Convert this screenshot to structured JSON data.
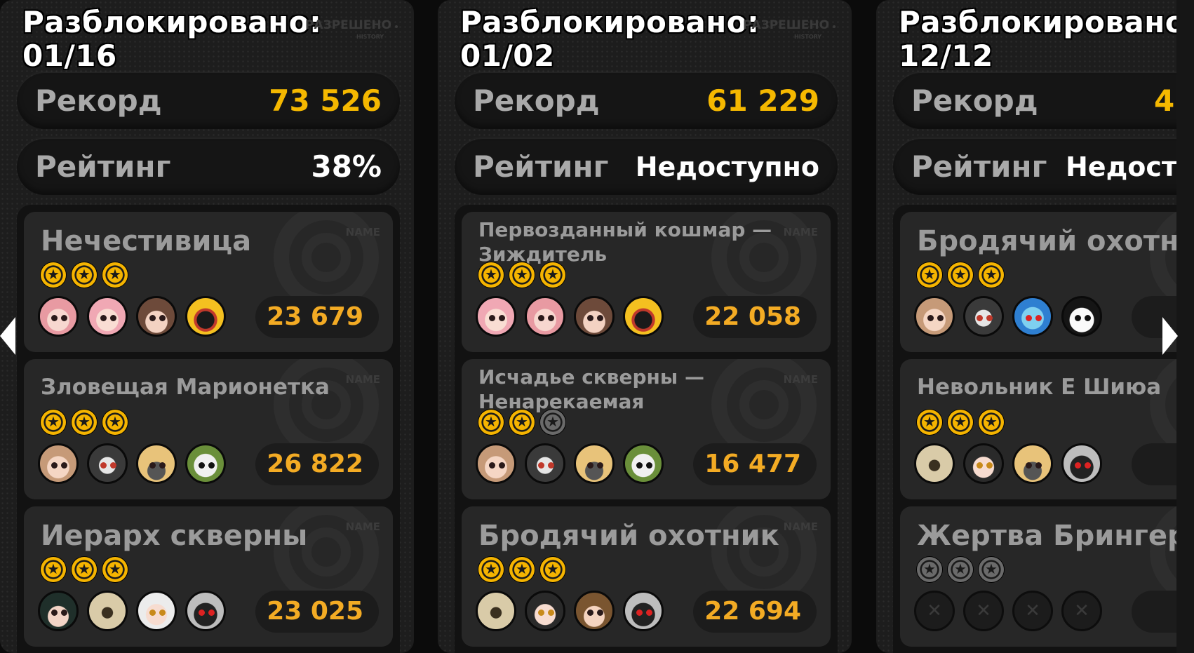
{
  "panels": [
    {
      "unlocked_label": "Разблокировано:",
      "unlocked_count": "01/16",
      "history_tag": "РАЗРЕШЕНО",
      "history_sub": "HISTORY",
      "record_label": "Рекорд",
      "record_value": "73 526",
      "rating_label": "Рейтинг",
      "rating_value": "38%",
      "cards": [
        {
          "title": "Нечестивица",
          "name_tag": "NAME",
          "score": "23 679",
          "stars": [
            true,
            true,
            true
          ],
          "avatars": [
            "pink-hair-girl-avatar",
            "pink-hair-girl-avatar",
            "brown-hair-girl-avatar",
            "yellow-hood-avatar"
          ]
        },
        {
          "title": "Зловещая Марионетка",
          "name_tag": "NAME",
          "score": "26 822",
          "stars": [
            true,
            true,
            true
          ],
          "avatars": [
            "blonde-girl-avatar",
            "bear-mascot-avatar",
            "blonde-mask-avatar",
            "robot-mascot-avatar"
          ]
        },
        {
          "title": "Иерарх скверны",
          "name_tag": "NAME",
          "score": "23 025",
          "stars": [
            true,
            true,
            true
          ],
          "avatars": [
            "dark-hair-girl-avatar",
            "armored-helmet-avatar",
            "white-hair-girl-avatar",
            "black-cat-robot-avatar"
          ]
        }
      ]
    },
    {
      "unlocked_label": "Разблокировано:",
      "unlocked_count": "01/02",
      "history_tag": "РАЗРЕШЕНО",
      "history_sub": "HISTORY",
      "record_label": "Рекорд",
      "record_value": "61 229",
      "rating_label": "Рейтинг",
      "rating_value": "Недоступно",
      "cards": [
        {
          "title": "Первозданный кошмар — Зиждитель",
          "name_tag": "NAME",
          "score": "22 058",
          "stars": [
            true,
            true,
            true
          ],
          "avatars": [
            "pink-hair-girl-avatar",
            "pink-hair-girl-avatar",
            "brown-hair-girl-avatar",
            "yellow-hood-avatar"
          ]
        },
        {
          "title": "Исчадье скверны — Ненарекаемая",
          "name_tag": "NAME",
          "score": "16 477",
          "stars": [
            true,
            true,
            false
          ],
          "avatars": [
            "blonde-girl-avatar",
            "bear-mascot-avatar",
            "blonde-mask-avatar",
            "robot-mascot-avatar"
          ]
        },
        {
          "title": "Бродячий охотник",
          "name_tag": "NAME",
          "score": "22 694",
          "stars": [
            true,
            true,
            true
          ],
          "avatars": [
            "armored-helmet-avatar",
            "white-hair-girl-avatar",
            "cap-girl-avatar",
            "black-cat-robot-avatar"
          ]
        }
      ]
    },
    {
      "unlocked_label": "Разблокировано:",
      "unlocked_count": "12/12",
      "record_label": "Рекорд",
      "record_value": "4",
      "rating_label": "Рейтинг",
      "rating_value": "Недост",
      "cards": [
        {
          "title": "Бродячий охотн",
          "stars": [
            true,
            true,
            true
          ],
          "avatars": [
            "blonde-girl-avatar",
            "bear-mascot-avatar",
            "blue-creature-avatar",
            "penguin-avatar"
          ]
        },
        {
          "title": "Невольник Е Шиюа",
          "stars": [
            true,
            true,
            true
          ],
          "avatars": [
            "armored-helmet-avatar",
            "white-hair-girl-avatar",
            "blonde-mask-avatar",
            "black-cat-robot-avatar"
          ]
        },
        {
          "title": "Жертва Брингер",
          "stars": [
            false,
            false,
            false
          ],
          "avatars": [
            "locked-slot-icon",
            "locked-slot-icon",
            "locked-slot-icon",
            "locked-slot-icon"
          ]
        }
      ]
    }
  ],
  "colors": {
    "gold": "#f5b800",
    "score": "#f3ab24",
    "panel": "#1d1d1d"
  },
  "icons": {
    "prev": "chevron-left-icon",
    "next": "chevron-right-icon"
  }
}
